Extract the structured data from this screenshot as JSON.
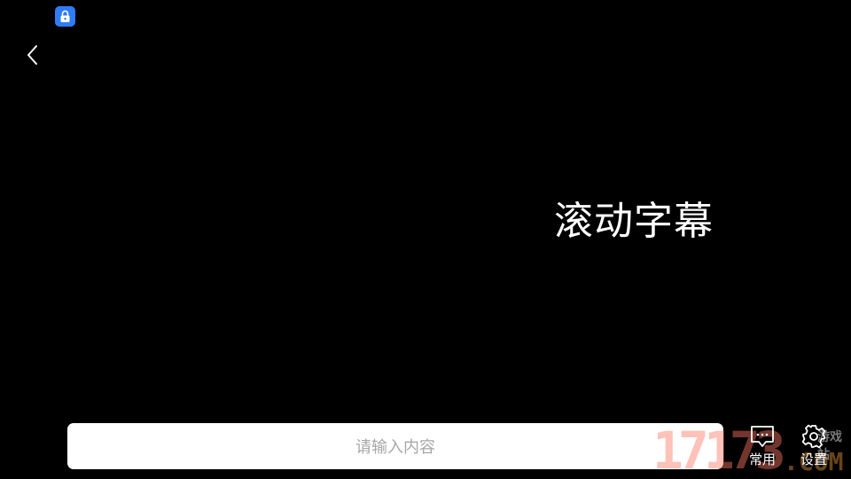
{
  "status_bar": {
    "lock_icon": "lock-icon",
    "lock_color": "#2f7cf6"
  },
  "header": {
    "back_icon": "chevron-left-icon"
  },
  "marquee": {
    "text": "滚动字幕",
    "color": "#ffffff",
    "background": "#000000"
  },
  "input": {
    "placeholder": "请输入内容",
    "value": ""
  },
  "toolbar": {
    "common": {
      "label": "常用",
      "icon": "message-icon"
    },
    "settings": {
      "label": "设置",
      "icon": "gear-icon"
    }
  },
  "watermark": {
    "number": "17173",
    "domain": ".COM",
    "site_label": "游戏站"
  }
}
